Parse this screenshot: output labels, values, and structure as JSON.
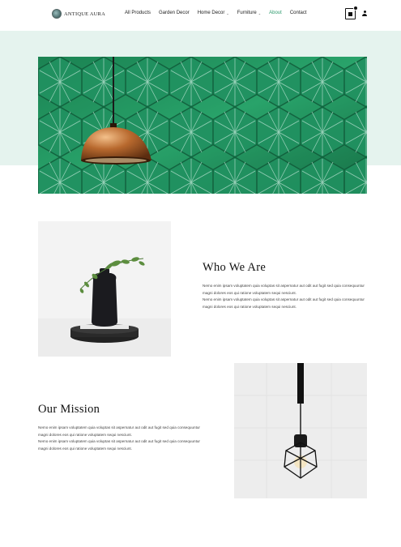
{
  "brand": {
    "logo_text": "ANTIQUE AURA",
    "accent_color": "#2f9b6e",
    "band_color": "#e5f3ee"
  },
  "nav": [
    {
      "label": "All Products",
      "has_dropdown": false,
      "active": false
    },
    {
      "label": "Garden Decor",
      "has_dropdown": false,
      "active": false
    },
    {
      "label": "Home Decor",
      "has_dropdown": true,
      "active": false
    },
    {
      "label": "Furniture",
      "has_dropdown": true,
      "active": false
    },
    {
      "label": "About",
      "has_dropdown": false,
      "active": true
    },
    {
      "label": "Contact",
      "has_dropdown": false,
      "active": false
    }
  ],
  "header_icons": [
    "shopping-bag-icon",
    "user-icon"
  ],
  "hero": {
    "image": "copper pendant lamp over green hexagon tile wall"
  },
  "who": {
    "title": "Who We Are",
    "paragraphs": [
      "Nemo enim ipsam voluptatem quia voluptas sit aspernatur aut odit aut fugit sed quia consequuntur magni dolores eos qui ratione voluptatem sequi nesciunt.",
      "Nemo enim ipsam voluptatem quia voluptas sit aspernatur aut odit aut fugit sed quia consequuntur magni dolores eos qui ratione voluptatem sequi nesciunt."
    ]
  },
  "mission": {
    "title": "Our Mission",
    "paragraphs": [
      "Nemo enim ipsam voluptatem quia voluptas sit aspernatur aut odit aut fugit sed quia consequuntur magni dolores eos qui ratione voluptatem sequi nesciunt.",
      "Nemo enim ipsam voluptatem quia voluptas sit aspernatur aut odit aut fugit sed quia consequuntur magni dolores eos qui ratione voluptatem sequi nesciunt."
    ]
  }
}
